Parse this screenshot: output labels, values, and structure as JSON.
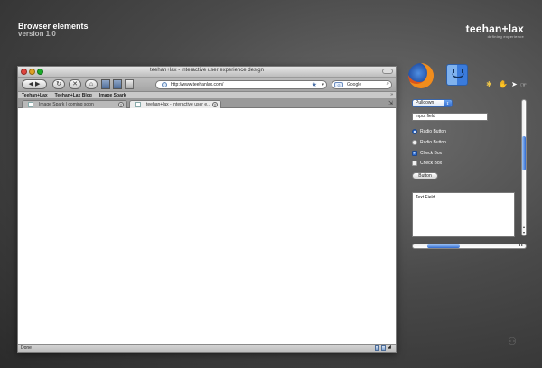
{
  "header": {
    "title": "Browser elements",
    "version": "version 1.0"
  },
  "brand": {
    "name": "teehan+lax",
    "tagline": "defining experience"
  },
  "browser": {
    "window_title": "teehan+lax - interactive user experience design",
    "url": "http://www.teehanlax.com/",
    "search_placeholder": "Google",
    "search_engine_label": "G",
    "bookmarks": [
      "Teehan+Lax",
      "Teehan+Lax Blog",
      "Image Spark"
    ],
    "bookmarks_more": "»",
    "tabs": [
      {
        "label": "Image Spark | coming soon"
      },
      {
        "label": "teehan+lax - interactive user e..."
      }
    ],
    "status": "Done"
  },
  "icons": {
    "firefox": "firefox-icon",
    "finder": "finder-icon",
    "cursors": [
      "arrow-cursor-icon",
      "hand-cursor-icon",
      "pointer-cursor-icon",
      "busy-cursor-icon"
    ]
  },
  "widgets": {
    "pulldown": "Pulldown",
    "input_field": "Input field",
    "radio_buttons": [
      {
        "label": "Radio Button",
        "checked": true
      },
      {
        "label": "Radio Button",
        "checked": false
      }
    ],
    "check_boxes": [
      {
        "label": "Check Box",
        "checked": true
      },
      {
        "label": "Check Box",
        "checked": false
      }
    ],
    "button": "Button",
    "text_field": "Text Field"
  },
  "colors": {
    "accent": "#2f6ad0",
    "background_dark": "#2b2b2b",
    "background_light": "#6e6e6e"
  }
}
